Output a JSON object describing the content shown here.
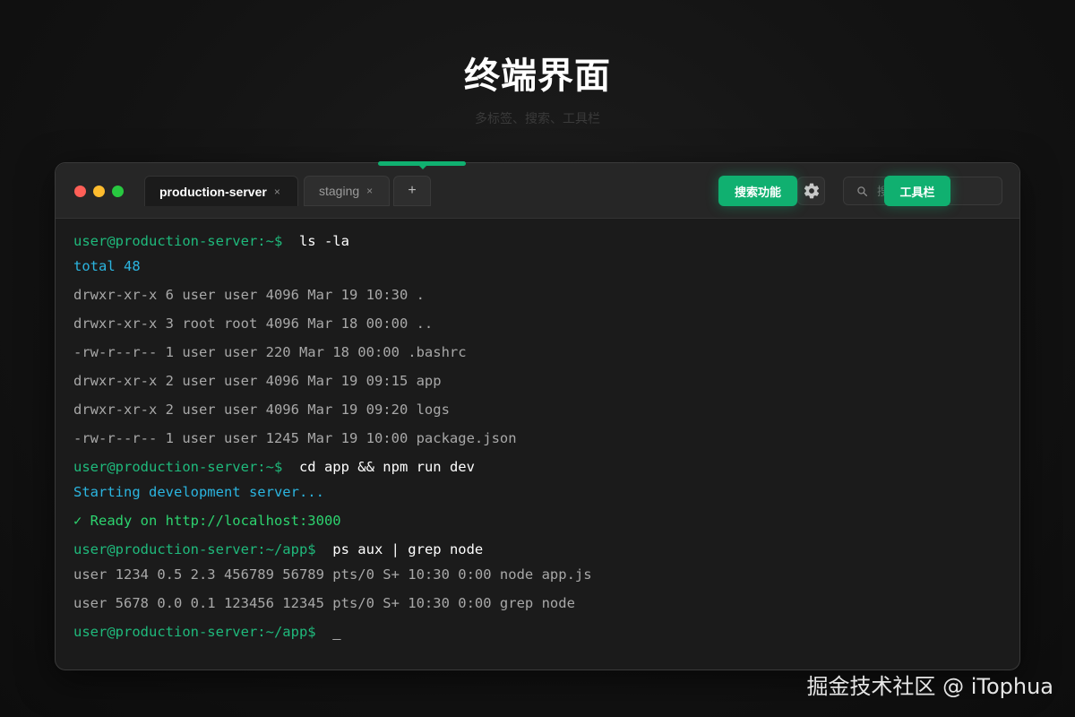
{
  "page": {
    "title": "终端界面",
    "subtitle": "多标签、搜索、工具栏"
  },
  "tabs": [
    {
      "label": "production-server",
      "close": "×",
      "active": true
    },
    {
      "label": "staging",
      "close": "×",
      "active": false
    }
  ],
  "new_tab_label": "+",
  "badges": {
    "search": "搜索功能",
    "toolbar": "工具栏"
  },
  "search": {
    "placeholder": "搜索"
  },
  "icons": {
    "settings": "gear-icon",
    "search": "search-icon",
    "close": "close-icon",
    "add": "plus-icon"
  },
  "colors": {
    "accent": "#10b070",
    "prompt": "#1fba7c",
    "info": "#2bb5e0",
    "success": "#2dd36f",
    "traffic_red": "#ff5f57",
    "traffic_yellow": "#febc2e",
    "traffic_green": "#28c840"
  },
  "terminal": {
    "lines": [
      {
        "prompt": "user@production-server:~$",
        "cmd": "ls -la"
      },
      {
        "text": "total 48",
        "style": "info"
      },
      {
        "text": "drwxr-xr-x 6 user user 4096 Mar 19 10:30 .",
        "style": "plain"
      },
      {
        "text": "drwxr-xr-x 3 root root 4096 Mar 18 00:00 ..",
        "style": "plain"
      },
      {
        "text": "-rw-r--r-- 1 user user 220 Mar 18 00:00 .bashrc",
        "style": "plain"
      },
      {
        "text": "drwxr-xr-x 2 user user 4096 Mar 19 09:15 app",
        "style": "plain"
      },
      {
        "text": "drwxr-xr-x 2 user user 4096 Mar 19 09:20 logs",
        "style": "plain"
      },
      {
        "text": "-rw-r--r-- 1 user user 1245 Mar 19 10:00 package.json",
        "style": "plain"
      },
      {
        "prompt": "user@production-server:~$",
        "cmd": "cd app && npm run dev"
      },
      {
        "text": "Starting development server...",
        "style": "info"
      },
      {
        "text": "✓ Ready on http://localhost:3000",
        "style": "success"
      },
      {
        "prompt": "user@production-server:~/app$",
        "cmd": "ps aux | grep node"
      },
      {
        "text": "user 1234 0.5 2.3 456789 56789 pts/0 S+ 10:30 0:00 node app.js",
        "style": "plain"
      },
      {
        "text": "user 5678 0.0 0.1 123456 12345 pts/0 S+ 10:30 0:00 grep node",
        "style": "plain"
      },
      {
        "prompt": "user@production-server:~/app$",
        "cmd": "_"
      }
    ]
  },
  "watermark": "掘金技术社区 @ iTophua"
}
